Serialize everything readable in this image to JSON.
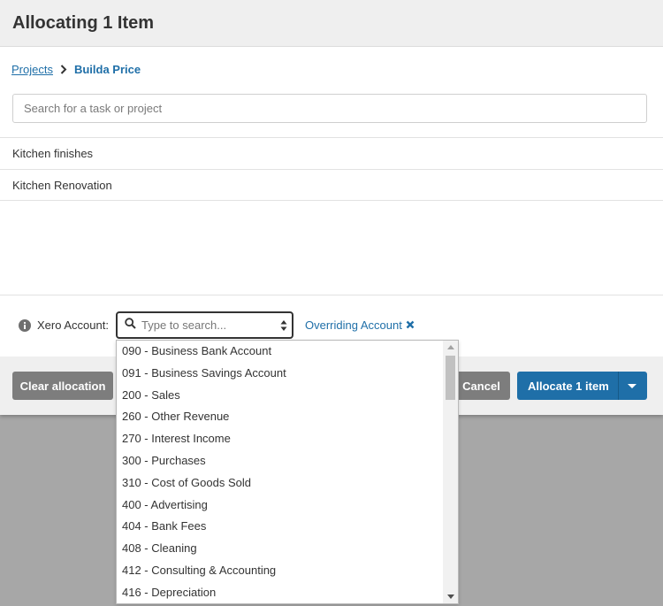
{
  "modal": {
    "title": "Allocating 1 Item"
  },
  "breadcrumb": {
    "parent": "Projects",
    "current": "Builda Price"
  },
  "search": {
    "placeholder": "Search for a task or project",
    "value": ""
  },
  "tasks": [
    "Kitchen finishes",
    "Kitchen Renovation"
  ],
  "account": {
    "label": "Xero Account:",
    "placeholder": "Type to search...",
    "override_text": "Overriding Account"
  },
  "dropdown": {
    "options": [
      "090 - Business Bank Account",
      "091 - Business Savings Account",
      "200 - Sales",
      "260 - Other Revenue",
      "270 - Interest Income",
      "300 - Purchases",
      "310 - Cost of Goods Sold",
      "400 - Advertising",
      "404 - Bank Fees",
      "408 - Cleaning",
      "412 - Consulting & Accounting",
      "416 - Depreciation"
    ]
  },
  "footer": {
    "clear_label": "Clear allocation",
    "cancel_label": "Cancel",
    "allocate_label": "Allocate 1 item"
  },
  "colors": {
    "brand_blue": "#1f6fa8",
    "grey_button": "#7d7d7d",
    "overlay": "#a7a7a7"
  },
  "icons": [
    "chevron-right-icon",
    "info-icon",
    "search-icon",
    "sort-arrows-icon",
    "close-icon",
    "caret-down-icon"
  ]
}
